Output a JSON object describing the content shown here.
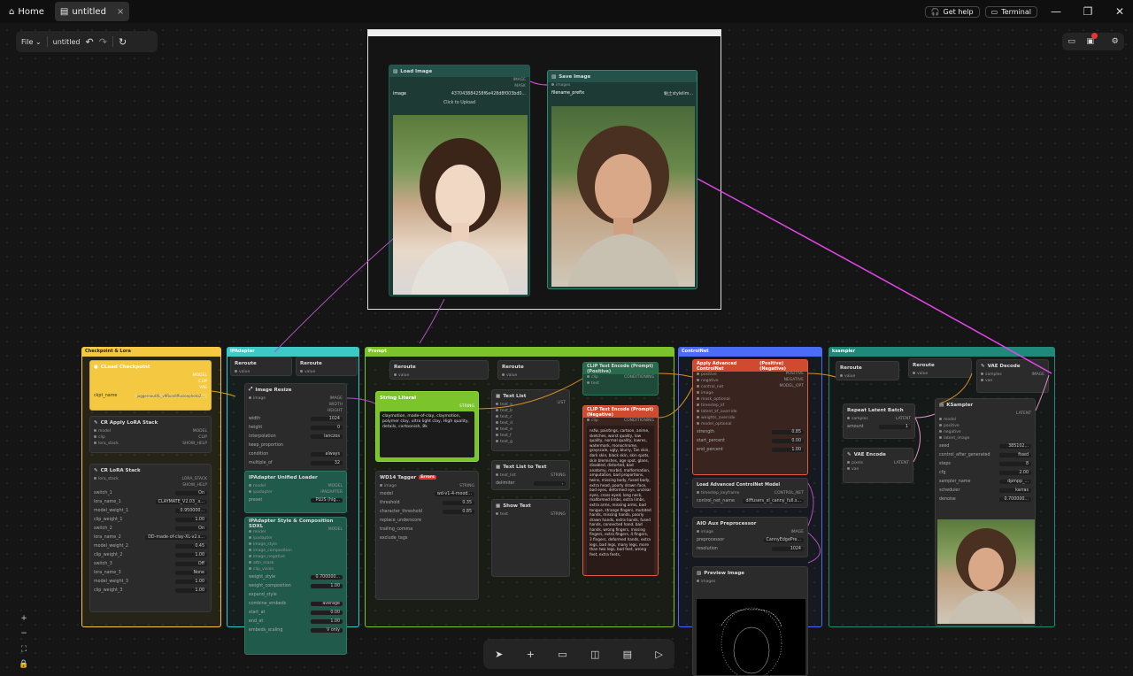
{
  "topbar": {
    "home_label": "Home",
    "tab_label": "untitled",
    "tab_close": "×",
    "help_label": "Get help",
    "terminal_label": "Terminal"
  },
  "menu": {
    "file_label": "File",
    "workflow_name": "untitled"
  },
  "preview_box": {
    "load_image": {
      "title": "Load Image",
      "out_image": "IMAGE",
      "out_mask": "MASK",
      "image_label": "image",
      "image_value": "437043884258f6e428d8f003bd0...",
      "upload_label": "Click to Upload"
    },
    "save_image": {
      "title": "Save Image",
      "in_images": "images",
      "prefix_label": "filename_prefix",
      "prefix_value": "黏土stylelim..."
    }
  },
  "groups": {
    "checkpoint": "Checkpoint & Lora",
    "ipadapter": "IPAdapter",
    "prompt": "Prompt",
    "controlnet": "ControlNet",
    "ksampler": "ksampler"
  },
  "checkpoint_nodes": {
    "loader": {
      "title": "CLoad Checkpoint",
      "out_model": "MODEL",
      "out_clip": "CLIP",
      "out_vae": "VAE",
      "ckpt_label": "ckpt_name",
      "ckpt_value": "juggernautXL_v9Rundiffusionphoto2..."
    },
    "apply_lora": {
      "title": "CR Apply LoRA Stack",
      "in_model": "model",
      "in_clip": "clip",
      "in_lora": "lora_stack",
      "out_model": "MODEL",
      "out_clip": "CLIP",
      "out_help": "SHOW_HELP"
    },
    "lora_stack": {
      "title": "CR LoRA Stack",
      "in_lora": "lora_stack",
      "out_stack": "LORA_STACK",
      "out_help": "SHOW_HELP",
      "rows": [
        {
          "label": "switch_1",
          "value": "On"
        },
        {
          "label": "lora_name_1",
          "value": "CLAYMATE_V2.03_.s..."
        },
        {
          "label": "model_weight_1",
          "value": "0.950000..."
        },
        {
          "label": "clip_weight_1",
          "value": "1.00"
        },
        {
          "label": "switch_2",
          "value": "On"
        },
        {
          "label": "lora_name_2",
          "value": "DD-made-of-clay-XL-v2.s..."
        },
        {
          "label": "model_weight_2",
          "value": "0.45"
        },
        {
          "label": "clip_weight_2",
          "value": "1.00"
        },
        {
          "label": "switch_3",
          "value": "Off"
        },
        {
          "label": "lora_name_3",
          "value": "None"
        },
        {
          "label": "model_weight_3",
          "value": "1.00"
        },
        {
          "label": "clip_weight_3",
          "value": "1.00"
        }
      ]
    }
  },
  "ipadapter_nodes": {
    "reroute1": "Reroute",
    "reroute2": "Reroute",
    "value": "value",
    "resize": {
      "title": "Image Resize",
      "in_image": "image",
      "out_image": "IMAGE",
      "out_width": "WIDTH",
      "out_height": "HEIGHT",
      "rows": [
        {
          "label": "width",
          "value": "1024"
        },
        {
          "label": "height",
          "value": "0"
        },
        {
          "label": "interpolation",
          "value": "lanczos"
        },
        {
          "label": "keep_proportion",
          "value": ""
        },
        {
          "label": "condition",
          "value": "always"
        },
        {
          "label": "multiple_of",
          "value": "32"
        }
      ]
    },
    "unified": {
      "title": "IPAdapter Unified Loader",
      "in_model": "model",
      "in_ipadapter": "ipadapter",
      "out_model": "MODEL",
      "out_ip": "IPADAPTER",
      "preset_label": "preset",
      "preset_value": "PLUS (hig..."
    },
    "style": {
      "title": "IPAdapter Style & Composition SDXL",
      "inputs": [
        "model",
        "ipadapter",
        "image_style",
        "image_composition",
        "image_negative",
        "attn_mask",
        "clip_vision"
      ],
      "out_model": "MODEL",
      "rows": [
        {
          "label": "weight_style",
          "value": "0.700000..."
        },
        {
          "label": "weight_composition",
          "value": "1.00"
        },
        {
          "label": "expand_style",
          "value": ""
        },
        {
          "label": "combine_embeds",
          "value": "average"
        },
        {
          "label": "start_at",
          "value": "0.00"
        },
        {
          "label": "end_at",
          "value": "1.00"
        },
        {
          "label": "embeds_scaling",
          "value": "V only"
        }
      ]
    }
  },
  "prompt_nodes": {
    "reroute1": "Reroute",
    "reroute2": "Reroute",
    "string_literal": {
      "title": "String Literal",
      "out": "STRING",
      "text": "claymotion, made-of-clay, claymotion, polymer clay, ultra light clay, High quality, details, cartoonish, 8k"
    },
    "tagger": {
      "title": "WD14 Tagger",
      "error_badge": "Errors",
      "in_image": "image",
      "out": "STRING",
      "rows": [
        {
          "label": "model",
          "value": "wd-v1-4-mood..."
        },
        {
          "label": "threshold",
          "value": "0.35"
        },
        {
          "label": "character_threshold",
          "value": "0.85"
        },
        {
          "label": "replace_underscore",
          "value": ""
        },
        {
          "label": "trailing_comma",
          "value": ""
        },
        {
          "label": "exclude_tags",
          "value": ""
        }
      ]
    },
    "text_list": {
      "title": "Text List",
      "out": "LIST",
      "inputs": [
        "text_a",
        "text_b",
        "text_c",
        "text_d",
        "text_e",
        "text_f",
        "text_g"
      ]
    },
    "list_to_text": {
      "title": "Text List to Text",
      "in": "text_list",
      "out": "STRING",
      "delim_label": "delimiter",
      "delim_value": ","
    },
    "show_text": {
      "title": "Show Text",
      "in": "text",
      "out": "STRING"
    },
    "clip_pos": {
      "title": "CLIP Text Encode (Prompt)(Positive)",
      "in_clip": "clip",
      "in_text": "text",
      "out": "CONDITIONING"
    },
    "clip_neg": {
      "title": "CLIP Text Encode (Prompt)(Negative)",
      "in_clip": "clip",
      "out": "CONDITIONING",
      "text": "nsfw, paintings, cartoon, anime, sketches, worst quality, low quality, normal quality, lowres, watermark, monochrome, grayscale, ugly, blurry, Tan skin, dark skin, black skin, skin spots, skin blemishes, age spot, glans, disabled, distorted, bad anatomy, morbid, malformation, amputation, bad proportions, twins, missing body, fused body, extra head, poorly drawn face, bad eyes, deformed eye, unclear eyes, cross-eyed, long neck, malformed limbs, extra limbs, extra arms, missing arms, bad tongue, strange fingers, mutated hands, missing hands, poorly drawn hands, extra hands, fused hands, connected hand, bad hands, wrong fingers, missing fingers, extra fingers, 4 fingers, 3 fingers, deformed hands, extra legs, bad legs, many legs, more than two legs, bad feet, wrong feet, extra feets,"
    }
  },
  "controlnet_nodes": {
    "apply": {
      "title": "Apply Advanced ControlNet",
      "badge": "(Positive)(Negative)",
      "inputs": [
        "positive",
        "negative",
        "control_net",
        "image",
        "mask_optional",
        "timestep_kf",
        "latent_kf_override",
        "weights_override",
        "model_optional"
      ],
      "out_pos": "POSITIVE",
      "out_neg": "NEGATIVE",
      "out_model": "MODEL_OPT",
      "rows": [
        {
          "label": "strength",
          "value": "0.85"
        },
        {
          "label": "start_percent",
          "value": "0.00"
        },
        {
          "label": "end_percent",
          "value": "1.00"
        }
      ]
    },
    "load": {
      "title": "Load Advanced ControlNet Model",
      "in": "timestep_keyframe",
      "out": "CONTROL_NET",
      "row_label": "control_net_name",
      "row_value": "diffusers_xl_canny_full.s..."
    },
    "aio": {
      "title": "AIO Aux Preprocessor",
      "in": "image",
      "out": "IMAGE",
      "rows": [
        {
          "label": "preprocessor",
          "value": "CannyEdgePre..."
        },
        {
          "label": "resolution",
          "value": "1024"
        }
      ]
    },
    "preview": {
      "title": "Preview Image",
      "in": "images"
    }
  },
  "ksampler_nodes": {
    "reroute1": "Reroute",
    "reroute2": "Reroute",
    "vae_decode": {
      "title": "VAE Decode",
      "in_samples": "samples",
      "in_vae": "vae",
      "out": "IMAGE"
    },
    "repeat": {
      "title": "Repeat Latent Batch",
      "in": "samples",
      "out": "LATENT",
      "amount_label": "amount",
      "amount_value": "1"
    },
    "vae_encode": {
      "title": "VAE Encode",
      "in_pixels": "pixels",
      "in_vae": "vae",
      "out": "LATENT"
    },
    "ksampler": {
      "title": "KSampler",
      "inputs": [
        "model",
        "positive",
        "negative",
        "latent_image"
      ],
      "out": "LATENT",
      "rows": [
        {
          "label": "seed",
          "value": "385102..."
        },
        {
          "label": "control_after_generated",
          "value": "fixed"
        },
        {
          "label": "steps",
          "value": "8"
        },
        {
          "label": "cfg",
          "value": "2.00"
        },
        {
          "label": "sampler_name",
          "value": "dpmpp_..."
        },
        {
          "label": "scheduler",
          "value": "karras"
        },
        {
          "label": "denoise",
          "value": "0.700000..."
        }
      ]
    }
  },
  "colors": {
    "checkpoint": "#f5c842",
    "ipadapter": "#3ec9c9",
    "prompt": "#7bc42c",
    "controlnet": "#4a6cf7",
    "ksampler": "#1f8a7a",
    "wire_pink": "#e246e8"
  }
}
